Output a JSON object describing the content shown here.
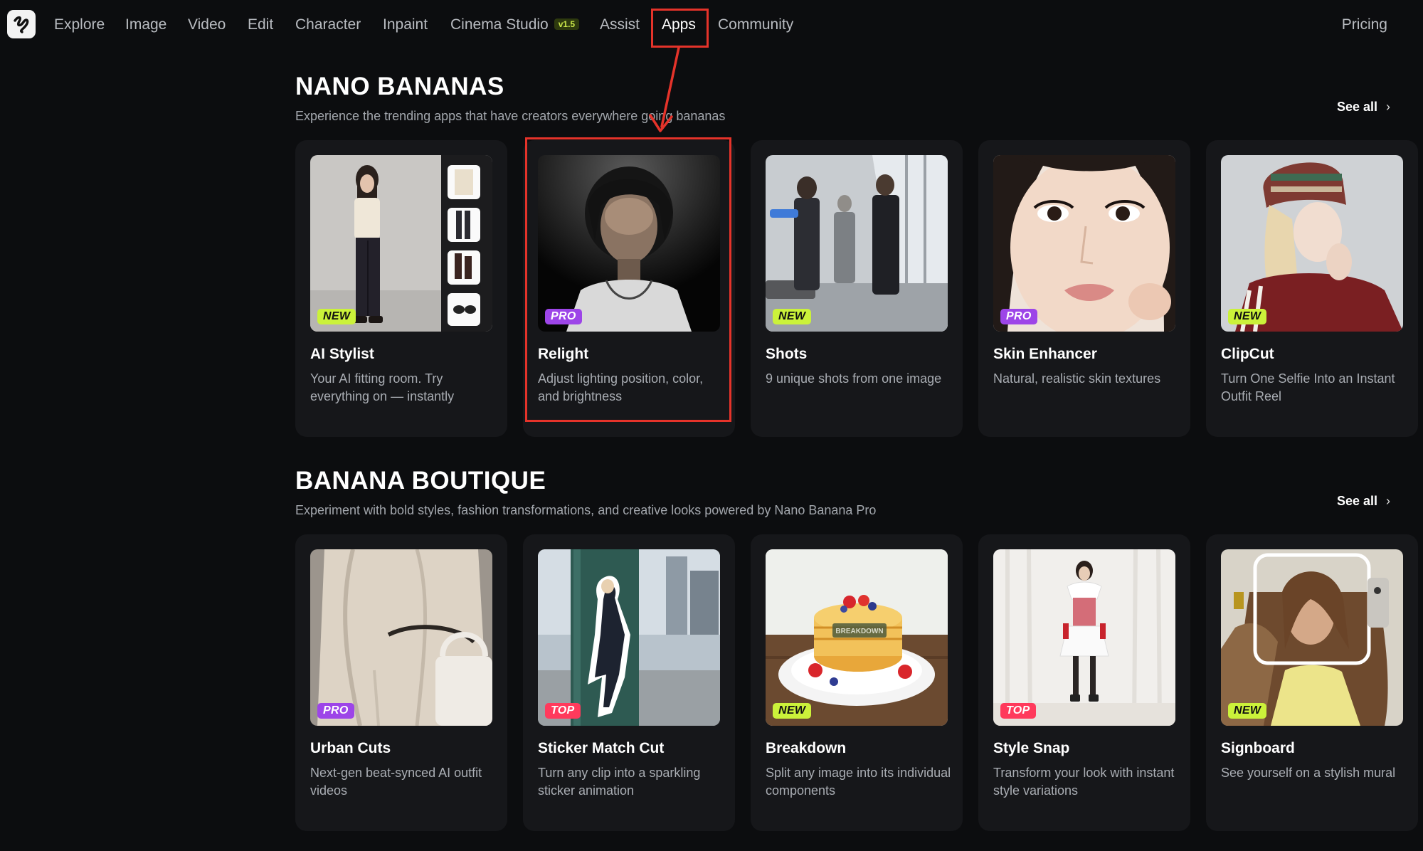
{
  "nav": {
    "items": [
      "Explore",
      "Image",
      "Video",
      "Edit",
      "Character",
      "Inpaint",
      "Cinema Studio",
      "Assist",
      "Apps",
      "Community"
    ],
    "cinema_badge": "v1.5",
    "pricing": "Pricing",
    "active": "Apps"
  },
  "sections": [
    {
      "title": "NANO BANANAS",
      "subtitle": "Experience the trending apps that have creators everywhere going bananas",
      "see_all": "See all",
      "cards": [
        {
          "title": "AI Stylist",
          "desc": "Your AI fitting room. Try everything on — instantly",
          "tag": "NEW"
        },
        {
          "title": "Relight",
          "desc": "Adjust lighting position, color, and brightness",
          "tag": "PRO"
        },
        {
          "title": "Shots",
          "desc": "9 unique shots from one image",
          "tag": "NEW"
        },
        {
          "title": "Skin Enhancer",
          "desc": "Natural, realistic skin textures",
          "tag": "PRO"
        },
        {
          "title": "ClipCut",
          "desc": "Turn One Selfie Into an Instant Outfit Reel",
          "tag": "NEW"
        }
      ]
    },
    {
      "title": "BANANA BOUTIQUE",
      "subtitle": "Experiment with bold styles, fashion transformations, and creative looks powered by Nano Banana Pro",
      "see_all": "See all",
      "cards": [
        {
          "title": "Urban Cuts",
          "desc": "Next-gen beat-synced AI outfit videos",
          "tag": "PRO"
        },
        {
          "title": "Sticker Match Cut",
          "desc": "Turn any clip into a sparkling sticker animation",
          "tag": "TOP"
        },
        {
          "title": "Breakdown",
          "desc": "Split any image into its individual components",
          "tag": "NEW"
        },
        {
          "title": "Style Snap",
          "desc": "Transform your look with instant style variations",
          "tag": "TOP"
        },
        {
          "title": "Signboard",
          "desc": "See yourself on a stylish mural",
          "tag": "NEW"
        }
      ]
    }
  ],
  "thumb_overlay_text": "BREAKDOWN",
  "colors": {
    "background": "#0c0d0f",
    "card": "#16171a",
    "tag_new": "#cbf23a",
    "tag_pro": "#9d45e8",
    "tag_top": "#ff3a5c",
    "annotation": "#e5332a"
  }
}
